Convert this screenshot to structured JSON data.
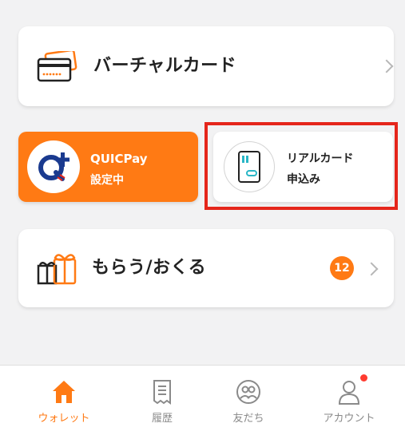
{
  "virtual_card": {
    "label": "バーチャルカード"
  },
  "quicpay": {
    "name": "QUICPay",
    "status": "設定中",
    "logo_text": "Q+"
  },
  "real_card": {
    "line1": "リアルカード",
    "line2": "申込み"
  },
  "receive_send": {
    "label": "もらう/おくる",
    "badge_count": "12"
  },
  "tabbar": {
    "tabs": [
      {
        "label": "ウォレット",
        "icon": "home-icon",
        "active": true
      },
      {
        "label": "履歴",
        "icon": "receipt-icon",
        "active": false
      },
      {
        "label": "友だち",
        "icon": "friends-icon",
        "active": false
      },
      {
        "label": "アカウント",
        "icon": "person-icon",
        "active": false
      }
    ]
  },
  "colors": {
    "accent": "#ff7a14",
    "highlight": "#e5261b",
    "notification": "#ff3b30"
  }
}
